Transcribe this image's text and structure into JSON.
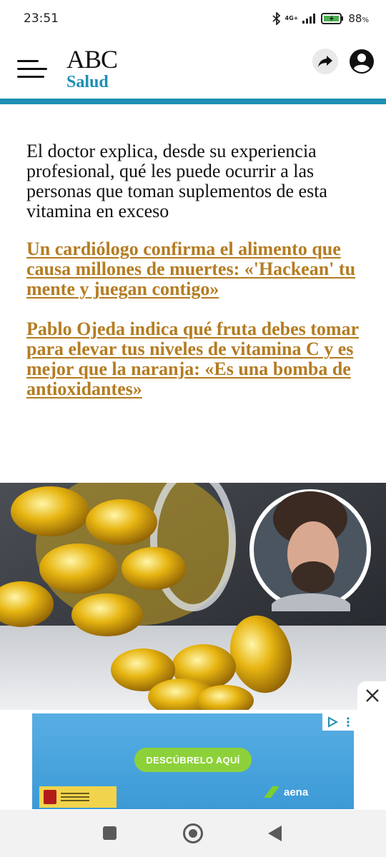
{
  "status_bar": {
    "time": "23:51",
    "network": "4G+",
    "battery": "88",
    "battery_unit": "%"
  },
  "header": {
    "brand": "ABC",
    "section": "Salud",
    "accent_color": "#1d8fb3",
    "icons": [
      "menu-icon",
      "share-icon",
      "profile-icon"
    ]
  },
  "article": {
    "lead": "El doctor explica, desde su experiencia profesional, qué les puede ocurrir a las personas que toman suplementos de esta vitamina en exceso",
    "related_links": [
      "Un cardiólogo confirma el alimento que causa millones de muertes: «'Hackean' tu mente y juegan contigo»",
      "Pablo Ojeda indica qué fruta debes tomar para elevar tus niveles de vitamina C y es mejor que la naranja: «Es una bomba de antioxidantes»"
    ],
    "link_color": "#b47c21"
  },
  "ad": {
    "cta": "DESCÚBRELO AQUÍ",
    "advertiser": "aena"
  },
  "nav_bar": {
    "icons": [
      "recents-icon",
      "home-icon",
      "back-icon"
    ]
  }
}
